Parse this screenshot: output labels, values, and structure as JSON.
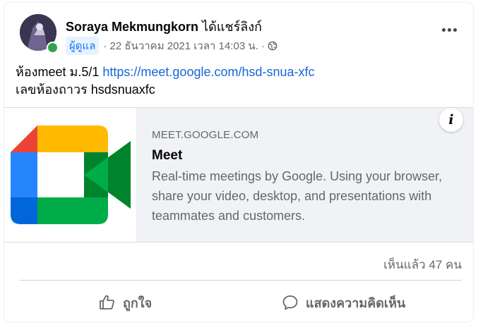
{
  "post": {
    "author": "Soraya Mekmungkorn",
    "action": "ได้แชร์ลิงก์",
    "badge": "ผู้ดูแล",
    "timestamp": "· 22 ธันวาคม 2021 เวลา 14:03 น. ·",
    "privacy_icon": "globe-icon",
    "line1_prefix": "ห้องmeet ม.5/1 ",
    "line1_link": "https://meet.google.com/hsd-snua-xfc",
    "line2": "เลขห้องถาวร hsdsnuaxfc"
  },
  "preview": {
    "domain": "MEET.GOOGLE.COM",
    "title": "Meet",
    "description": "Real-time meetings by Google. Using your browser, share your video, desktop, and presentations with teammates and customers.",
    "info_label": "i"
  },
  "footer": {
    "views": "เห็นแล้ว 47 คน",
    "like_label": "ถูกใจ",
    "comment_label": "แสดงความคิดเห็น"
  },
  "colors": {
    "link": "#1467d8",
    "badge_bg": "#e7f3ff",
    "online": "#31a24c",
    "secondary_text": "#65676b"
  }
}
